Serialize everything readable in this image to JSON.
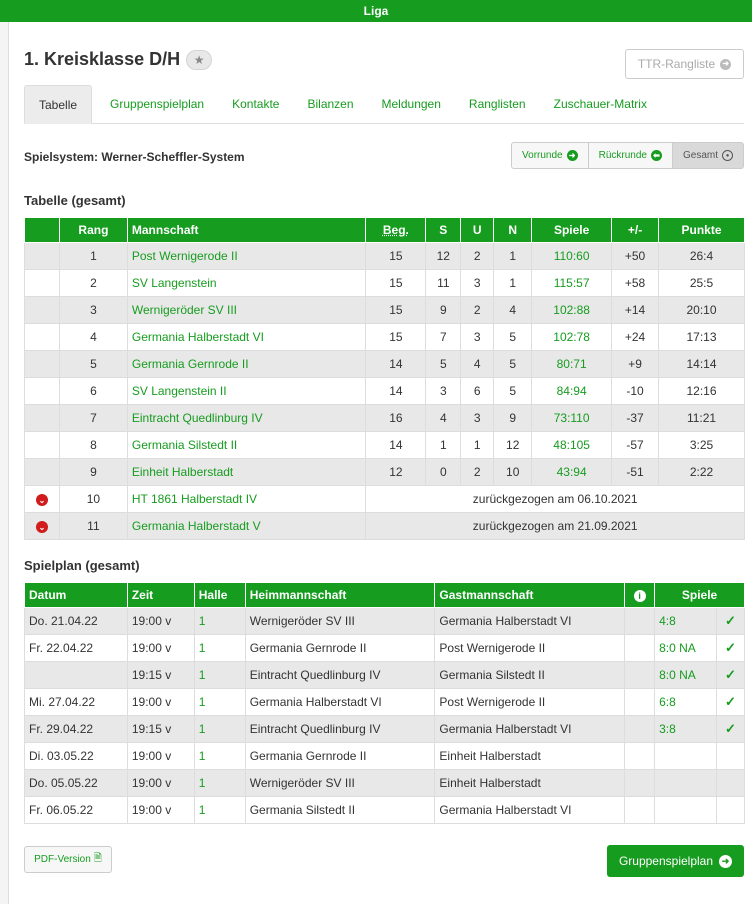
{
  "header": {
    "title": "Liga"
  },
  "page": {
    "title": "1. Kreisklasse D/H",
    "ttr_label": "TTR-Rangliste"
  },
  "tabs": [
    "Tabelle",
    "Gruppenspielplan",
    "Kontakte",
    "Bilanzen",
    "Meldungen",
    "Ranglisten",
    "Zuschauer-Matrix"
  ],
  "spielsystem": "Spielsystem: Werner-Scheffler-System",
  "round_buttons": [
    "Vorrunde",
    "Rückrunde",
    "Gesamt"
  ],
  "table_section": {
    "title": "Tabelle (gesamt)",
    "headers": [
      "",
      "Rang",
      "Mannschaft",
      "Beg.",
      "S",
      "U",
      "N",
      "Spiele",
      "+/-",
      "Punkte"
    ],
    "rows": [
      {
        "rang": "1",
        "team": "Post Wernigerode II",
        "beg": "15",
        "s": "12",
        "u": "2",
        "n": "1",
        "spiele": "110:60",
        "diff": "+50",
        "punkte": "26:4"
      },
      {
        "rang": "2",
        "team": "SV Langenstein",
        "beg": "15",
        "s": "11",
        "u": "3",
        "n": "1",
        "spiele": "115:57",
        "diff": "+58",
        "punkte": "25:5"
      },
      {
        "rang": "3",
        "team": "Wernigeröder SV III",
        "beg": "15",
        "s": "9",
        "u": "2",
        "n": "4",
        "spiele": "102:88",
        "diff": "+14",
        "punkte": "20:10"
      },
      {
        "rang": "4",
        "team": "Germania Halberstadt VI",
        "beg": "15",
        "s": "7",
        "u": "3",
        "n": "5",
        "spiele": "102:78",
        "diff": "+24",
        "punkte": "17:13"
      },
      {
        "rang": "5",
        "team": "Germania Gernrode II",
        "beg": "14",
        "s": "5",
        "u": "4",
        "n": "5",
        "spiele": "80:71",
        "diff": "+9",
        "punkte": "14:14"
      },
      {
        "rang": "6",
        "team": "SV Langenstein II",
        "beg": "14",
        "s": "3",
        "u": "6",
        "n": "5",
        "spiele": "84:94",
        "diff": "-10",
        "punkte": "12:16"
      },
      {
        "rang": "7",
        "team": "Eintracht Quedlinburg IV",
        "beg": "16",
        "s": "4",
        "u": "3",
        "n": "9",
        "spiele": "73:110",
        "diff": "-37",
        "punkte": "11:21"
      },
      {
        "rang": "8",
        "team": "Germania Silstedt II",
        "beg": "14",
        "s": "1",
        "u": "1",
        "n": "12",
        "spiele": "48:105",
        "diff": "-57",
        "punkte": "3:25"
      },
      {
        "rang": "9",
        "team": "Einheit Halberstadt",
        "beg": "12",
        "s": "0",
        "u": "2",
        "n": "10",
        "spiele": "43:94",
        "diff": "-51",
        "punkte": "2:22"
      }
    ],
    "withdrawn": [
      {
        "rang": "10",
        "team": "HT 1861 Halberstadt IV",
        "note": "zurückgezogen am 06.10.2021"
      },
      {
        "rang": "11",
        "team": "Germania Halberstadt V",
        "note": "zurückgezogen am 21.09.2021"
      }
    ]
  },
  "schedule_section": {
    "title": "Spielplan (gesamt)",
    "headers": [
      "Datum",
      "Zeit",
      "Halle",
      "Heimmannschaft",
      "Gastmannschaft",
      "",
      "Spiele"
    ],
    "rows": [
      {
        "datum": "Do. 21.04.22",
        "zeit": "19:00 v",
        "halle": "1",
        "heim": "Wernigeröder SV III",
        "gast": "Germania Halberstadt VI",
        "spiele": "4:8",
        "done": true
      },
      {
        "datum": "Fr. 22.04.22",
        "zeit": "19:00 v",
        "halle": "1",
        "heim": "Germania Gernrode II",
        "gast": "Post Wernigerode II",
        "spiele": "8:0 NA",
        "done": true
      },
      {
        "datum": "",
        "zeit": "19:15 v",
        "halle": "1",
        "heim": "Eintracht Quedlinburg IV",
        "gast": "Germania Silstedt II",
        "spiele": "8:0 NA",
        "done": true
      },
      {
        "datum": "Mi. 27.04.22",
        "zeit": "19:00 v",
        "halle": "1",
        "heim": "Germania Halberstadt VI",
        "gast": "Post Wernigerode II",
        "spiele": "6:8",
        "done": true
      },
      {
        "datum": "Fr. 29.04.22",
        "zeit": "19:15 v",
        "halle": "1",
        "heim": "Eintracht Quedlinburg IV",
        "gast": "Germania Halberstadt VI",
        "spiele": "3:8",
        "done": true
      },
      {
        "datum": "Di. 03.05.22",
        "zeit": "19:00 v",
        "halle": "1",
        "heim": "Germania Gernrode II",
        "gast": "Einheit Halberstadt",
        "spiele": "",
        "done": false
      },
      {
        "datum": "Do. 05.05.22",
        "zeit": "19:00 v",
        "halle": "1",
        "heim": "Wernigeröder SV III",
        "gast": "Einheit Halberstadt",
        "spiele": "",
        "done": false
      },
      {
        "datum": "Fr. 06.05.22",
        "zeit": "19:00 v",
        "halle": "1",
        "heim": "Germania Silstedt II",
        "gast": "Germania Halberstadt VI",
        "spiele": "",
        "done": false
      }
    ]
  },
  "footer": {
    "pdf_label": "PDF-Version",
    "gruppenspielplan_label": "Gruppenspielplan"
  },
  "colors": {
    "brand": "#169c1f",
    "danger": "#d01c1c"
  }
}
